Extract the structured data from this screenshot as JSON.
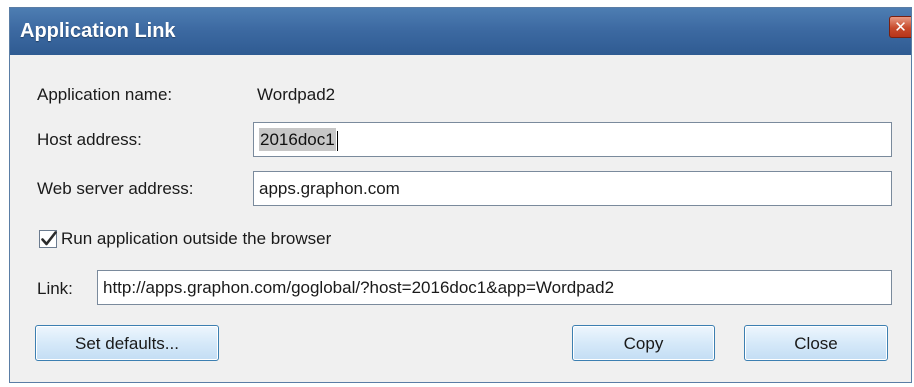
{
  "window": {
    "title": "Application Link",
    "close_glyph": "✕"
  },
  "fields": {
    "app_name_label": "Application name:",
    "app_name_value": "Wordpad2",
    "host_label": "Host address:",
    "host_value": "2016doc1",
    "web_server_label": "Web server address:",
    "web_server_value": "apps.graphon.com",
    "run_outside_label": "Run application outside the browser",
    "run_outside_checked": true,
    "link_label": "Link:",
    "link_value": "http://apps.graphon.com/goglobal/?host=2016doc1&app=Wordpad2"
  },
  "buttons": {
    "set_defaults": "Set defaults...",
    "copy": "Copy",
    "close": "Close"
  },
  "colors": {
    "titlebar": "#3d6aa2",
    "close_button": "#c84a2c",
    "button_border": "#3c7fb1",
    "dialog_background": "#f0f0f0"
  },
  "icons": {
    "close": "close-icon",
    "check": "checkmark-icon"
  }
}
